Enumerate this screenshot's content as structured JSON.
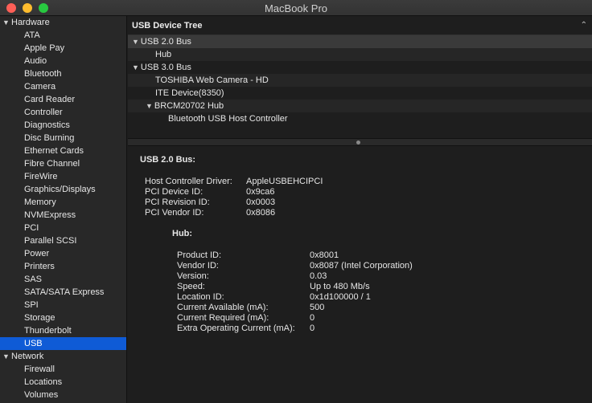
{
  "window": {
    "title": "MacBook Pro"
  },
  "sidebar": {
    "sections": [
      {
        "label": "Hardware",
        "items": [
          "ATA",
          "Apple Pay",
          "Audio",
          "Bluetooth",
          "Camera",
          "Card Reader",
          "Controller",
          "Diagnostics",
          "Disc Burning",
          "Ethernet Cards",
          "Fibre Channel",
          "FireWire",
          "Graphics/Displays",
          "Memory",
          "NVMExpress",
          "PCI",
          "Parallel SCSI",
          "Power",
          "Printers",
          "SAS",
          "SATA/SATA Express",
          "SPI",
          "Storage",
          "Thunderbolt",
          "USB"
        ]
      },
      {
        "label": "Network",
        "items": [
          "Firewall",
          "Locations",
          "Volumes"
        ]
      }
    ],
    "selected": "USB"
  },
  "tree": {
    "header": "USB Device Tree",
    "rows": [
      {
        "label": "USB 2.0 Bus",
        "expanded": true,
        "selected": true
      },
      {
        "label": "Hub"
      },
      {
        "label": "USB 3.0 Bus",
        "expanded": true
      },
      {
        "label": "TOSHIBA Web Camera - HD"
      },
      {
        "label": "ITE Device(8350)"
      },
      {
        "label": "BRCM20702 Hub",
        "expanded": true
      },
      {
        "label": "Bluetooth USB Host Controller"
      }
    ]
  },
  "detail": {
    "title": "USB 2.0 Bus:",
    "bus_fields": [
      {
        "key": "Host Controller Driver:",
        "value": "AppleUSBEHCIPCI"
      },
      {
        "key": "PCI Device ID:",
        "value": "0x9ca6"
      },
      {
        "key": "PCI Revision ID:",
        "value": "0x0003"
      },
      {
        "key": "PCI Vendor ID:",
        "value": "0x8086"
      }
    ],
    "hub_title": "Hub:",
    "hub_fields": [
      {
        "key": "Product ID:",
        "value": "0x8001"
      },
      {
        "key": "Vendor ID:",
        "value": "0x8087  (Intel Corporation)"
      },
      {
        "key": "Version:",
        "value": "0.03"
      },
      {
        "key": "Speed:",
        "value": "Up to 480 Mb/s"
      },
      {
        "key": "Location ID:",
        "value": "0x1d100000 / 1"
      },
      {
        "key": "Current Available (mA):",
        "value": "500"
      },
      {
        "key": "Current Required (mA):",
        "value": "0"
      },
      {
        "key": "Extra Operating Current (mA):",
        "value": "0"
      }
    ]
  },
  "colors": {
    "selection": "#0f5bd6",
    "close": "#fe5f57",
    "minimize": "#febc2e",
    "maximize": "#28c840"
  }
}
